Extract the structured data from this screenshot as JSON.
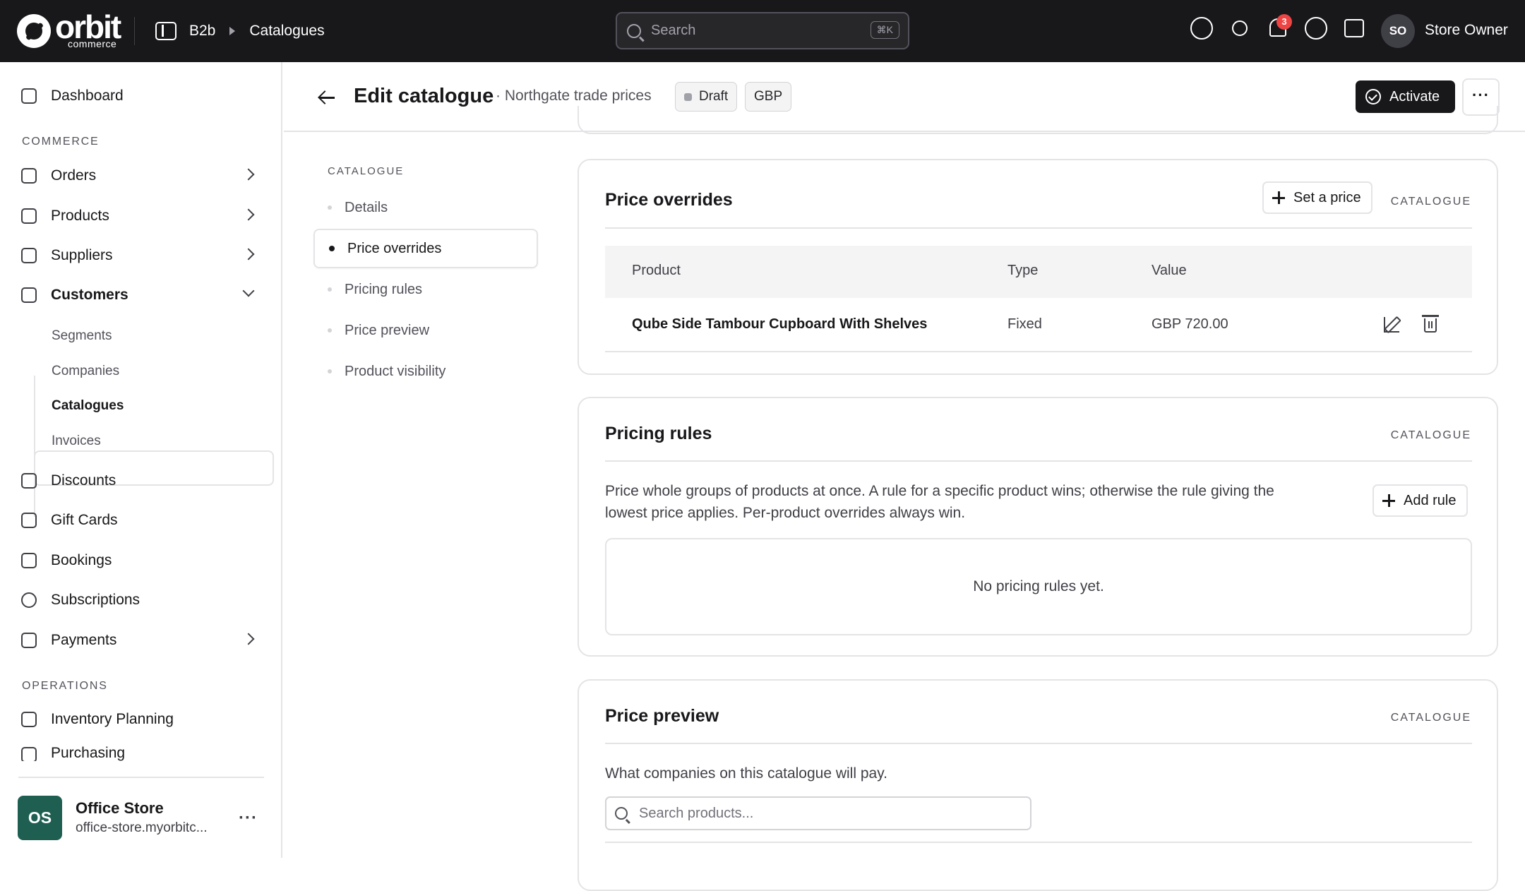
{
  "topbar": {
    "logo_text": "orbit",
    "logo_sub": "commerce",
    "breadcrumb": [
      "B2b",
      "Catalogues"
    ],
    "search": {
      "placeholder": "Search",
      "shortcut": "⌘K"
    },
    "notification_count": "3",
    "user_initials": "SO",
    "user_name": "Store Owner",
    "icons": [
      "pause-icon",
      "sun-icon",
      "bell-icon",
      "help-icon",
      "store-icon"
    ]
  },
  "sidebar": {
    "dashboard": "Dashboard",
    "commerce_label": "COMMERCE",
    "commerce_items": [
      "Orders",
      "Products",
      "Suppliers",
      "Customers"
    ],
    "customers_sub": [
      "Segments",
      "Companies",
      "Catalogues",
      "Invoices"
    ],
    "more_items": [
      "Discounts",
      "Gift Cards",
      "Bookings",
      "Subscriptions",
      "Payments"
    ],
    "operations_label": "OPERATIONS",
    "operations_items": [
      "Inventory Planning",
      "Purchasing"
    ],
    "store": {
      "initials": "OS",
      "name": "Office Store",
      "url": "office-store.myorbitc..."
    }
  },
  "header": {
    "title": "Edit catalogue",
    "subtitle": "· Northgate trade prices",
    "status": "Draft",
    "currency": "GBP",
    "activate_label": "Activate",
    "more_label": "···"
  },
  "inpage_nav": {
    "label": "CATALOGUE",
    "items": [
      "Details",
      "Price overrides",
      "Pricing rules",
      "Price preview",
      "Product visibility"
    ],
    "active": "Price overrides"
  },
  "price_overrides": {
    "title": "Price overrides",
    "tag": "CATALOGUE",
    "set_price_label": "Set a price",
    "columns": [
      "Product",
      "Type",
      "Value"
    ],
    "rows": [
      {
        "product": "Qube Side Tambour Cupboard With Shelves",
        "type": "Fixed",
        "value": "GBP 720.00"
      }
    ]
  },
  "pricing_rules": {
    "title": "Pricing rules",
    "tag": "CATALOGUE",
    "description_line1": "Price whole groups of products at once. A rule for a specific product wins; otherwise the rule giving the",
    "description_line2": "lowest price applies. Per-product overrides always win.",
    "add_rule_label": "Add rule",
    "empty_text": "No pricing rules yet."
  },
  "price_preview": {
    "title": "Price preview",
    "tag": "CATALOGUE",
    "description": "What companies on this catalogue will pay.",
    "search_placeholder": "Search products..."
  }
}
